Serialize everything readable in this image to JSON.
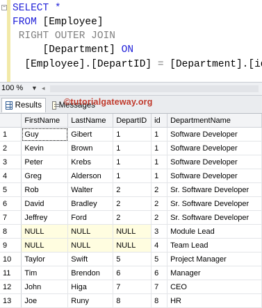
{
  "editor": {
    "line1": "SELECT *",
    "line2_kw": "FROM",
    "line2_rest": " [Employee]",
    "line3": "RIGHT OUTER JOIN",
    "line4_rest": "[Department] ",
    "line4_kw": "ON",
    "line5_a": "[Employee].[DepartID]",
    "line5_eq": " = ",
    "line5_b": "[Department].[id]"
  },
  "zoom": {
    "value": "100 %"
  },
  "tabs": {
    "results": "Results",
    "messages": "Messages"
  },
  "watermark": "©tutorialgateway.org",
  "grid": {
    "columns": [
      "FirstName",
      "LastName",
      "DepartID",
      "id",
      "DepartmentName"
    ],
    "rows": [
      {
        "n": "1",
        "first": "Guy",
        "last": "Gibert",
        "dep": "1",
        "id": "1",
        "name": "Software Developer"
      },
      {
        "n": "2",
        "first": "Kevin",
        "last": "Brown",
        "dep": "1",
        "id": "1",
        "name": "Software Developer"
      },
      {
        "n": "3",
        "first": "Peter",
        "last": "Krebs",
        "dep": "1",
        "id": "1",
        "name": "Software Developer"
      },
      {
        "n": "4",
        "first": "Greg",
        "last": "Alderson",
        "dep": "1",
        "id": "1",
        "name": "Software Developer"
      },
      {
        "n": "5",
        "first": "Rob",
        "last": "Walter",
        "dep": "2",
        "id": "2",
        "name": "Sr. Software Developer"
      },
      {
        "n": "6",
        "first": "David",
        "last": "Bradley",
        "dep": "2",
        "id": "2",
        "name": "Sr. Software Developer"
      },
      {
        "n": "7",
        "first": "Jeffrey",
        "last": "Ford",
        "dep": "2",
        "id": "2",
        "name": "Sr. Software Developer"
      },
      {
        "n": "8",
        "first": "NULL",
        "last": "NULL",
        "dep": "NULL",
        "id": "3",
        "name": "Module Lead"
      },
      {
        "n": "9",
        "first": "NULL",
        "last": "NULL",
        "dep": "NULL",
        "id": "4",
        "name": "Team Lead"
      },
      {
        "n": "10",
        "first": "Taylor",
        "last": "Swift",
        "dep": "5",
        "id": "5",
        "name": "Project Manager"
      },
      {
        "n": "11",
        "first": "Tim",
        "last": "Brendon",
        "dep": "6",
        "id": "6",
        "name": "Manager"
      },
      {
        "n": "12",
        "first": "John",
        "last": "Higa",
        "dep": "7",
        "id": "7",
        "name": "CEO"
      },
      {
        "n": "13",
        "first": "Joe",
        "last": "Runy",
        "dep": "8",
        "id": "8",
        "name": "HR"
      }
    ]
  }
}
